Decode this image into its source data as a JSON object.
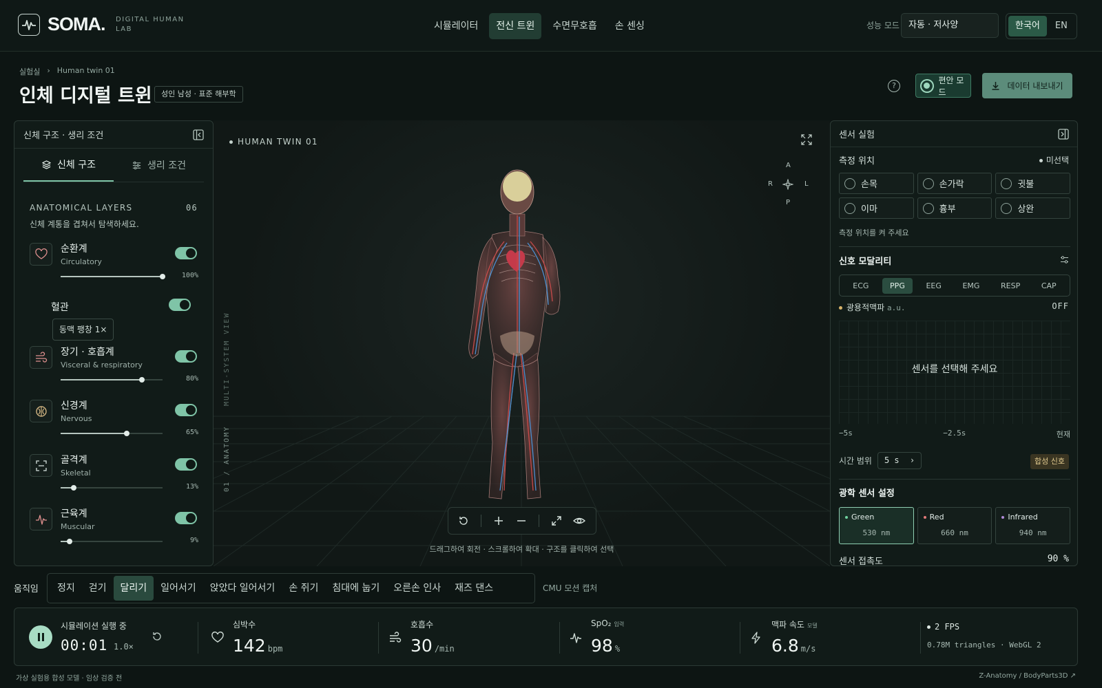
{
  "brand": {
    "name": "SOMA.",
    "sub": "DIGITAL HUMAN LAB"
  },
  "nav": [
    {
      "label": "시뮬레이터",
      "active": false
    },
    {
      "label": "전신 트윈",
      "active": true
    },
    {
      "label": "수면무호흡",
      "active": false
    },
    {
      "label": "손 센싱",
      "active": false
    }
  ],
  "perf": {
    "label": "성능 모드",
    "value": "자동 · 저사양"
  },
  "lang": {
    "ko": "한국어",
    "en": "EN",
    "active": "ko"
  },
  "breadcrumb": {
    "root": "실험실",
    "current": "Human twin 01"
  },
  "page": {
    "title": "인체 디지털 트윈",
    "tag": "성인 남성 · 표준 해부학"
  },
  "actions": {
    "help": "?",
    "comfort": "편안 모드",
    "export": "데이터 내보내기"
  },
  "left_panel": {
    "title": "신체 구조 · 생리 조건",
    "tabs": [
      {
        "label": "신체 구조",
        "active": true
      },
      {
        "label": "생리 조건",
        "active": false
      }
    ],
    "layers_title": "ANATOMICAL LAYERS",
    "layers_count": "06",
    "layers_desc": "신체 계통을 겹쳐서 탐색하세요.",
    "layers": [
      {
        "name": "순환계",
        "en": "Circulatory",
        "icon": "heart-icon",
        "on": true,
        "value": 100,
        "pct": "100%"
      },
      {
        "name": "장기 · 호흡계",
        "en": "Visceral & respiratory",
        "icon": "wind-icon",
        "on": true,
        "value": 80,
        "pct": "80%"
      },
      {
        "name": "신경계",
        "en": "Nervous",
        "icon": "brain-icon",
        "on": true,
        "value": 65,
        "pct": "65%"
      },
      {
        "name": "골격계",
        "en": "Skeletal",
        "icon": "skeleton-scan-icon",
        "on": true,
        "value": 13,
        "pct": "13%"
      },
      {
        "name": "근육계",
        "en": "Muscular",
        "icon": "pulse-icon",
        "on": true,
        "value": 9,
        "pct": "9%"
      }
    ],
    "sub_layer": {
      "name": "혈관",
      "on": true,
      "chip": "동맥 팽창 1×"
    }
  },
  "viewport": {
    "label": "HUMAN TWIN 01",
    "vertical_top": "MULTI-SYSTEM VIEW",
    "vertical_bottom": "01 / ANATOMY",
    "compass": {
      "a": "A",
      "p": "P",
      "r": "R",
      "l": "L"
    },
    "hint": "드래그하여 회전 · 스크롤하여 확대 · 구조를 클릭하여 선택"
  },
  "right_panel": {
    "title": "센서 실험",
    "location_label": "측정 위치",
    "location_status": "미선택",
    "locations": [
      "손목",
      "손가락",
      "귓불",
      "이마",
      "흉부",
      "상완"
    ],
    "location_hint": "측정 위치를 켜 주세요",
    "modality_title": "신호 모달리티",
    "modalities": [
      {
        "label": "ECG",
        "active": false
      },
      {
        "label": "PPG",
        "active": true
      },
      {
        "label": "EEG",
        "active": false
      },
      {
        "label": "EMG",
        "active": false
      },
      {
        "label": "RESP",
        "active": false
      },
      {
        "label": "CAP",
        "active": false
      }
    ],
    "wave_label": "광용적맥파",
    "wave_unit": "a.u.",
    "wave_state": "OFF",
    "wave_msg": "센서를 선택해 주세요",
    "time_ticks": [
      "−5s",
      "−2.5s",
      "현재"
    ],
    "range_label": "시간 범위",
    "range_value": "5 s",
    "synthetic": "합성 신호",
    "optical_title": "광학 센서 설정",
    "optical": [
      {
        "name": "Green",
        "nm": "530 nm",
        "color": "#6fd39f",
        "active": true
      },
      {
        "name": "Red",
        "nm": "660 nm",
        "color": "#e37a7a",
        "active": false
      },
      {
        "name": "Infrared",
        "nm": "940 nm",
        "color": "#b08ad8",
        "active": false
      }
    ],
    "contact_label": "센서 접촉도",
    "contact_value": "90 %"
  },
  "motion": {
    "label": "움직임",
    "items": [
      {
        "label": "정지",
        "active": false
      },
      {
        "label": "걷기",
        "active": false
      },
      {
        "label": "달리기",
        "active": true
      },
      {
        "label": "일어서기",
        "active": false
      },
      {
        "label": "앉았다 일어서기",
        "active": false
      },
      {
        "label": "손 쥐기",
        "active": false
      },
      {
        "label": "침대에 눕기",
        "active": false
      },
      {
        "label": "오른손 인사",
        "active": false
      },
      {
        "label": "재즈 댄스",
        "active": false
      }
    ],
    "source": "CMU 모션 캡처"
  },
  "status": {
    "run_label": "시뮬레이션 실행 중",
    "time": "00:01",
    "speed": "1.0×",
    "metrics": [
      {
        "label": "심박수",
        "note": "",
        "value": "142",
        "unit": "bpm",
        "icon": "heart-icon"
      },
      {
        "label": "호흡수",
        "note": "",
        "value": "30",
        "unit": "/min",
        "icon": "wind-icon"
      },
      {
        "label": "SpO₂",
        "note": "입력",
        "value": "98",
        "unit": "%",
        "icon": "pulse-icon"
      },
      {
        "label": "맥파 속도",
        "note": "모델",
        "value": "6.8",
        "unit": "m/s",
        "icon": "lightning-icon"
      }
    ],
    "fps": "2 FPS",
    "triangles": "0.78M triangles · WebGL 2"
  },
  "footer": {
    "left": "가상 실험용 합성 모델 · 임상 검증 전",
    "right": "Z-Anatomy / BodyParts3D ↗"
  }
}
